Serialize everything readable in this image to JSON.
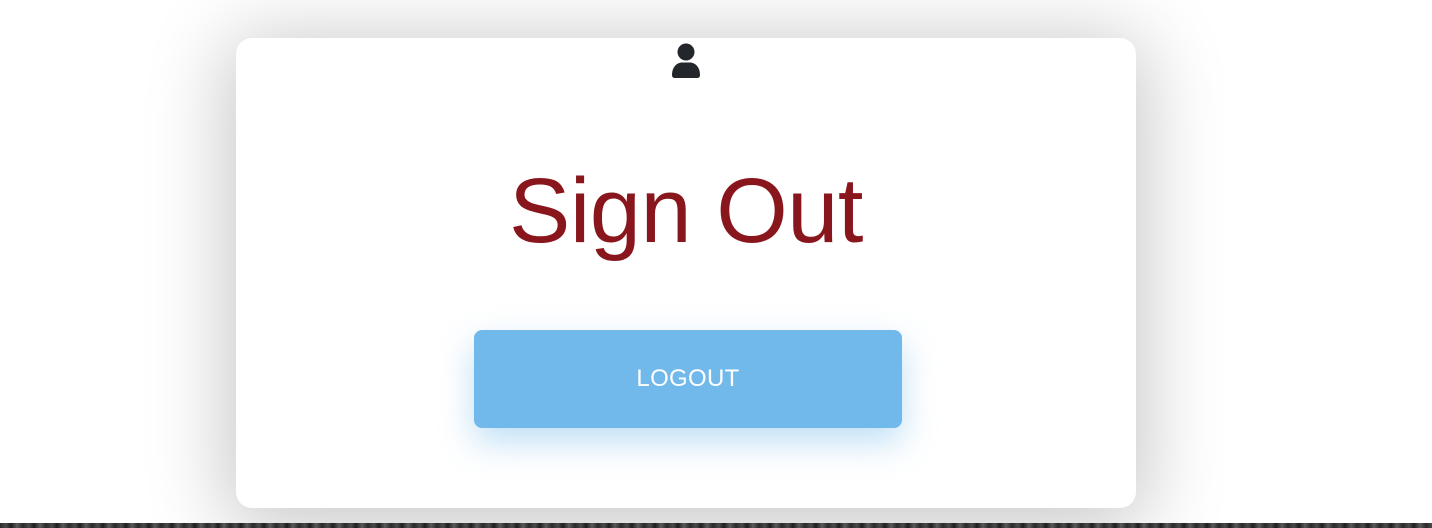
{
  "card": {
    "icon": "user-icon",
    "title": "Sign Out",
    "logout_label": "LOGOUT"
  },
  "colors": {
    "title": "#8a161d",
    "button": "#72b9eb",
    "icon": "#23272b"
  }
}
